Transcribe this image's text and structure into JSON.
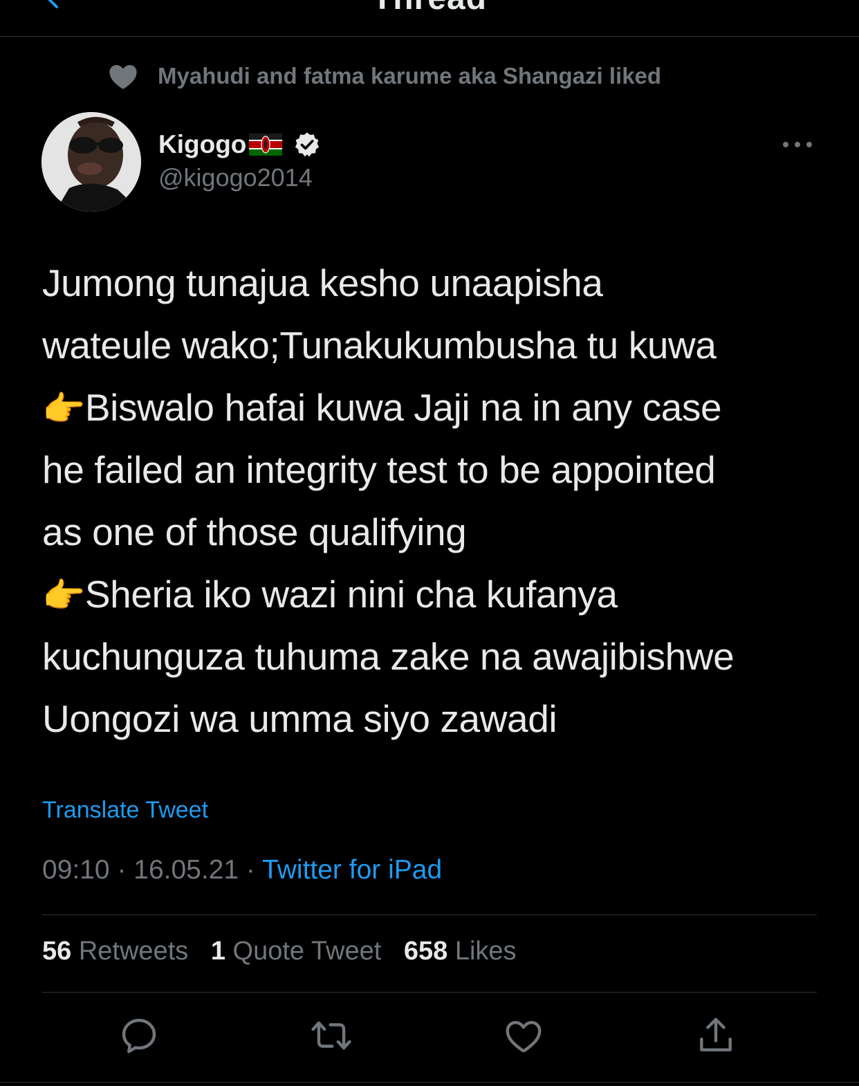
{
  "nav": {
    "title": "Thread"
  },
  "social_context": {
    "text": "Myahudi and fatma karume aka Shangazi liked"
  },
  "author": {
    "name": "Kigogo",
    "handle": "@kigogo2014",
    "flag_icon": "kenya-flag-icon",
    "verified_icon": "verified-badge-icon"
  },
  "tweet": {
    "lines": [
      "Jumong tunajua kesho unaapisha",
      "wateule wako;Tunakukumbusha tu kuwa",
      "Biswalo hafai kuwa Jaji na in any case",
      "he failed an integrity test to be appointed",
      "as one of those qualifying",
      "Sheria iko wazi nini cha kufanya",
      "kuchunguza tuhuma zake na awajibishwe",
      "Uongozi wa umma siyo zawadi"
    ],
    "pointing_emoji": "👉"
  },
  "translate_label": "Translate Tweet",
  "meta": {
    "time": "09:10",
    "separator": " · ",
    "date": "16.05.21",
    "source": "Twitter for iPad"
  },
  "stats": {
    "retweets_count": "56",
    "retweets_label": "Retweets",
    "quotes_count": "1",
    "quotes_label": "Quote Tweet",
    "likes_count": "658",
    "likes_label": "Likes"
  },
  "actions": [
    "reply-icon",
    "retweet-icon",
    "like-icon",
    "share-icon"
  ],
  "colors": {
    "background": "#000000",
    "text": "#e7e9ea",
    "secondary": "#71767b",
    "accent": "#1d9bf0",
    "divider": "#2f3336"
  }
}
